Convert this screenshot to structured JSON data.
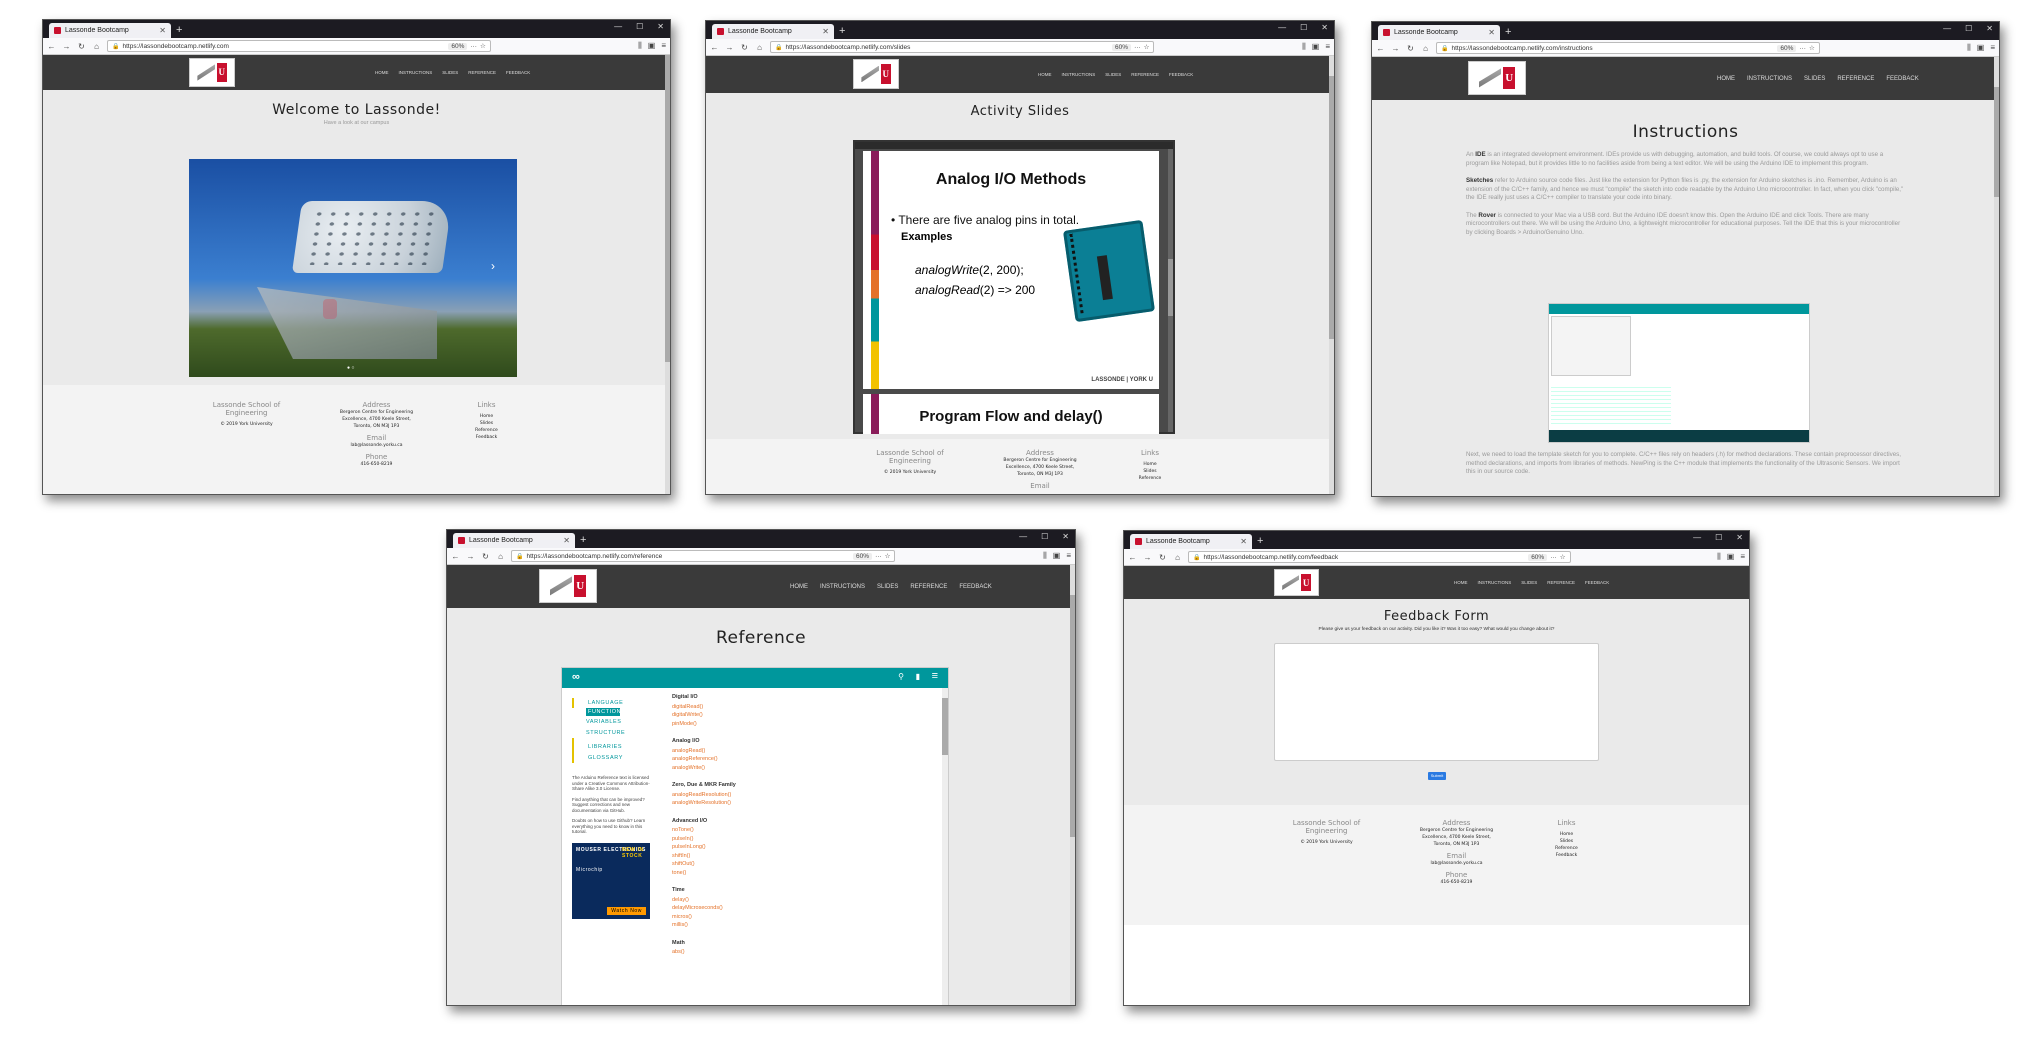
{
  "tab_title": "Lassonde Bootcamp",
  "zoom": "60%",
  "footer": {
    "school": "Lassonde School of Engineering",
    "copyright": "© 2019 York University",
    "address_h": "Address",
    "address": "Bergeron Centre for Engineering Excellence, 4700 Keele Street, Toronto, ON M3J 1P3",
    "email_h": "Email",
    "email": "lab@lassonde.yorku.ca",
    "phone_h": "Phone",
    "phone": "416-650-8219",
    "links_h": "Links",
    "links": [
      "Home",
      "Slides",
      "Reference",
      "Feedback"
    ]
  },
  "windows": {
    "home": {
      "url": "https://lassondebootcamp.netlify.com",
      "menu": [
        "HOME",
        "INSTRUCTIONS",
        "SLIDES",
        "REFERENCE",
        "FEEDBACK"
      ],
      "title": "Welcome to Lassonde!",
      "subtitle": "Have a look at our campus"
    },
    "slides": {
      "url": "https://lassondebootcamp.netlify.com/slides",
      "menu": [
        "HOME",
        "INSTRUCTIONS",
        "SLIDES",
        "REFERENCE",
        "FEEDBACK"
      ],
      "title": "Activity Slides",
      "slide1_title": "Analog I/O Methods",
      "slide1_bullet": "There are five analog pins in total.",
      "slide1_examples": "Examples",
      "slide1_code1_fn": "analogWrite",
      "slide1_code1_args": "(2, 200);",
      "slide1_code2_fn": "analogRead",
      "slide1_code2_args": "(2) => 200",
      "slide1_brand": "LASSONDE | YORK U",
      "slide2_title": "Program Flow and delay()"
    },
    "instructions": {
      "url": "https://lassondebootcamp.netlify.com/instructions",
      "menu": [
        "HOME",
        "INSTRUCTIONS",
        "SLIDES",
        "REFERENCE",
        "FEEDBACK"
      ],
      "title": "Instructions",
      "p1_pre": "An ",
      "p1_bold": "IDE",
      "p1_post": " is an integrated development environment. IDEs provide us with debugging, automation, and build tools. Of course, we could always opt to use a program like Notepad, but it provides little to no facilities aside from being a text editor. We will be using the Arduino IDE to implement this program.",
      "p2_bold": "Sketches",
      "p2_post": " refer to Arduino source code files. Just like the extension for Python files is .py, the extension for Arduino sketches is .ino. Remember, Arduino is an extension of the C/C++ family, and hence we must \"compile\" the sketch into code readable by the Arduino Uno microcontroller. In fact, when you click \"compile,\" the IDE really just uses a C/C++ compiler to translate your code into binary.",
      "p3_pre": "The ",
      "p3_bold": "Rover",
      "p3_post": " is connected to your Mac via a USB cord. But the Arduino IDE doesn't know this. Open the Arduino IDE and click Tools. There are many microcontrollers out there. We will be using the Arduino Uno, a lightweight microcontroller for educational purposes. Tell the IDE that this is your microcontroller by clicking Boards > Arduino/Genuino Uno.",
      "p4": "Next, we need to load the template sketch for you to complete. C/C++ files rely on headers (.h) for method declarations. These contain preprocessor directives, method declarations, and imports from libraries of methods. NewPing is the C++ module that implements the functionality of the Ultrasonic Sensors. We import this in our source code."
    },
    "reference": {
      "url": "https://lassondebootcamp.netlify.com/reference",
      "menu": [
        "HOME",
        "INSTRUCTIONS",
        "SLIDES",
        "REFERENCE",
        "FEEDBACK"
      ],
      "title": "Reference",
      "nav": [
        "LANGUAGE",
        "FUNCTIONS",
        "VARIABLES",
        "STRUCTURE",
        "LIBRARIES",
        "GLOSSARY"
      ],
      "license": "The Arduino Reference text is licensed under a Creative Commons Attribution-Share Alike 3.0 License.",
      "improve": "Find anything that can be improved? Suggest corrections and new documentation via GitHub.",
      "doubts": "Doubts on how to use Github? Learn everything you need to know in this tutorial.",
      "ad_brand": "MOUSER ELECTRONICS",
      "ad_new": "NEW IN STOCK",
      "ad_chip": "Microchip",
      "ad_btn": "Watch Now",
      "sections": [
        {
          "h": "Digital I/O",
          "items": [
            "digitalRead()",
            "digitalWrite()",
            "pinMode()"
          ]
        },
        {
          "h": "Analog I/O",
          "items": [
            "analogRead()",
            "analogReference()",
            "analogWrite()"
          ]
        },
        {
          "h": "Zero, Due & MKR Family",
          "items": [
            "analogReadResolution()",
            "analogWriteResolution()"
          ]
        },
        {
          "h": "Advanced I/O",
          "items": [
            "noTone()",
            "pulseIn()",
            "pulseInLong()",
            "shiftIn()",
            "shiftOut()",
            "tone()"
          ]
        },
        {
          "h": "Time",
          "items": [
            "delay()",
            "delayMicroseconds()",
            "micros()",
            "millis()"
          ]
        },
        {
          "h": "Math",
          "items": [
            "abs()"
          ]
        }
      ]
    },
    "feedback": {
      "url": "https://lassondebootcamp.netlify.com/feedback",
      "menu": [
        "HOME",
        "INSTRUCTIONS",
        "SLIDES",
        "REFERENCE",
        "FEEDBACK"
      ],
      "title": "Feedback Form",
      "prompt": "Please give us your feedback on our activity. Did you like it? Was it too easy? What would you change about it?",
      "submit": "Submit"
    }
  },
  "colors": {
    "header": "#3a3a3a",
    "arduino_teal": "#00979c",
    "link_orange": "#e47128",
    "york_red": "#c8102e"
  }
}
